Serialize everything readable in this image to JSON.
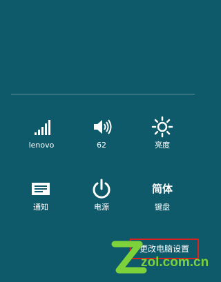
{
  "tiles": {
    "network": {
      "label": "lenovo",
      "icon": "wifi-signal-icon"
    },
    "volume": {
      "label": "62",
      "icon": "speaker-volume-icon"
    },
    "brightness": {
      "label": "亮度",
      "icon": "sun-brightness-icon"
    },
    "notifications": {
      "label": "通知",
      "icon": "notification-message-icon"
    },
    "power": {
      "label": "电源",
      "icon": "power-icon"
    },
    "keyboard": {
      "ime": "简体",
      "label": "键盘"
    }
  },
  "footer": {
    "change_settings_label": "更改电脑设置",
    "watermark_text": "zol.com.cn",
    "accent_color": "#d8231f",
    "watermark_color": "#7dd13a"
  },
  "colors": {
    "background": "#0f5a6a",
    "foreground": "#ffffff"
  }
}
